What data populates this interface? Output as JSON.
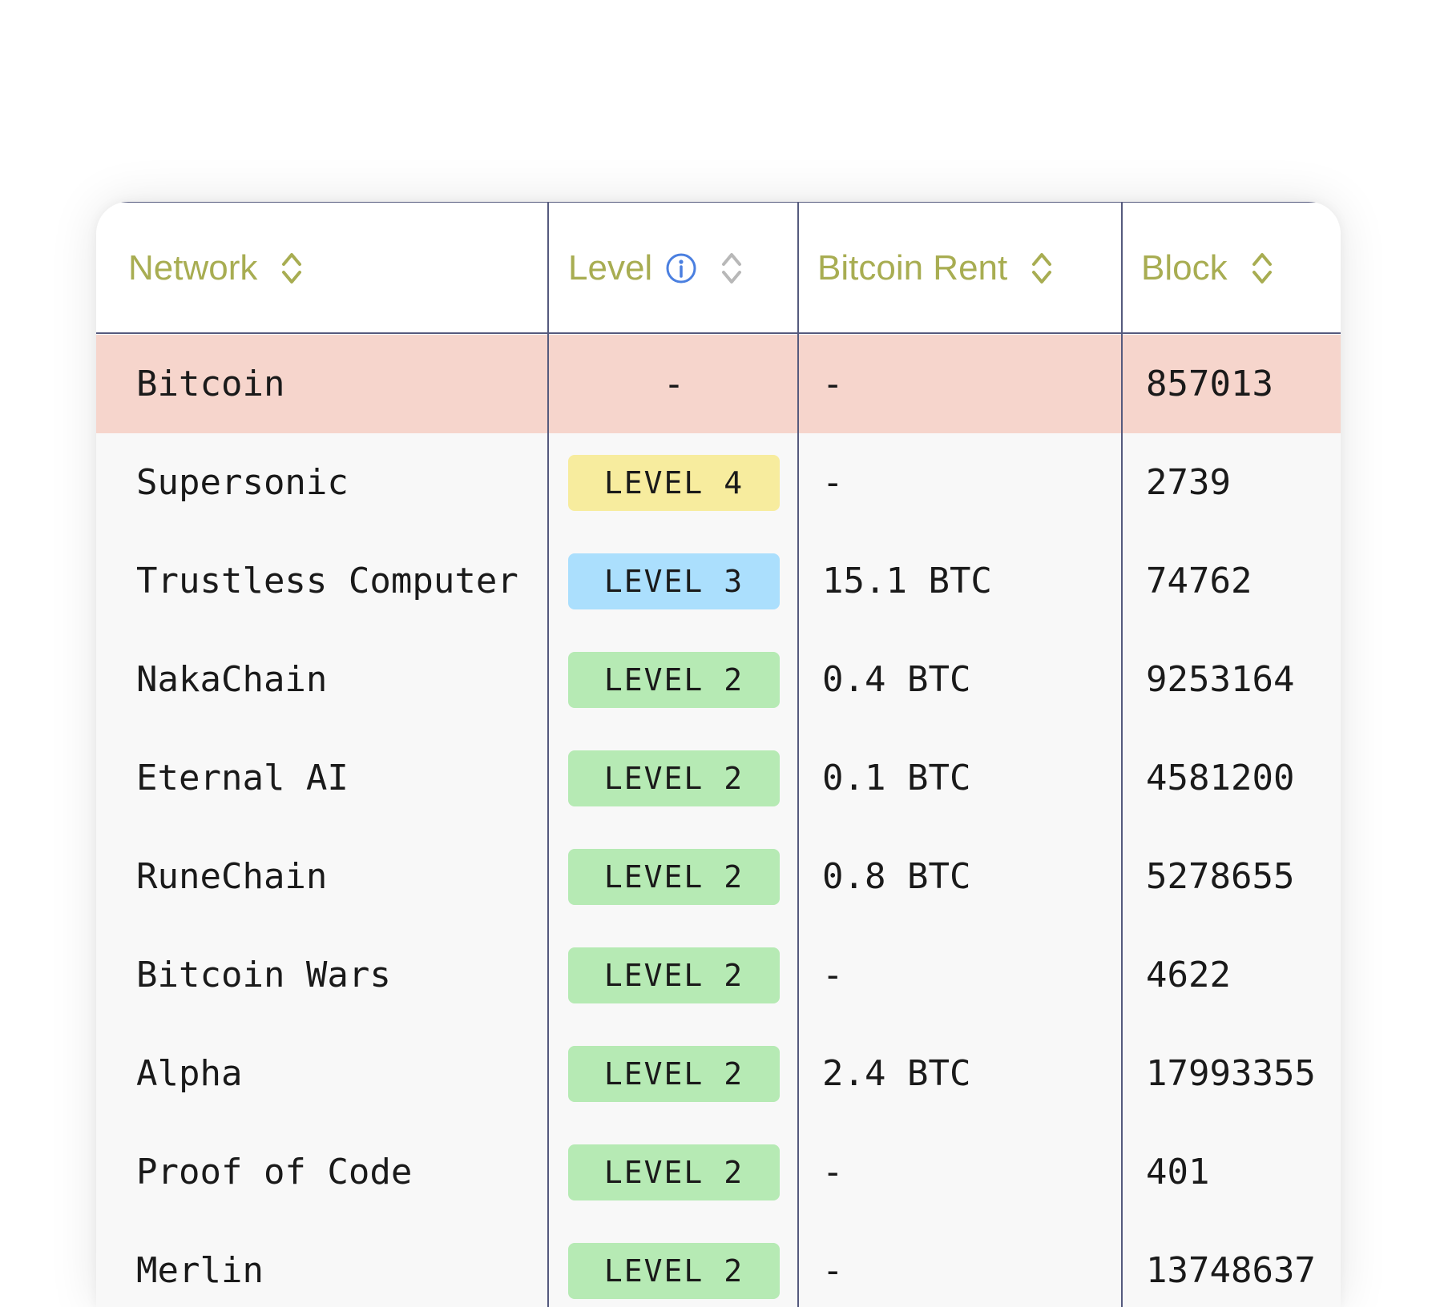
{
  "table": {
    "columns": [
      {
        "label": "Network",
        "info": false
      },
      {
        "label": "Level",
        "info": true
      },
      {
        "label": "Bitcoin Rent",
        "info": false
      },
      {
        "label": "Block",
        "info": false
      }
    ],
    "rows": [
      {
        "network": "Bitcoin",
        "level": "-",
        "rent": "-",
        "block": "857013",
        "highlight": true
      },
      {
        "network": "Supersonic",
        "level": "LEVEL 4",
        "level_color": "#f7ec9e",
        "rent": "-",
        "block": "2739"
      },
      {
        "network": "Trustless Computer",
        "level": "LEVEL 3",
        "level_color": "#abdffd",
        "rent": "15.1 BTC",
        "block": "74762"
      },
      {
        "network": "NakaChain",
        "level": "LEVEL 2",
        "level_color": "#b6eab4",
        "rent": "0.4 BTC",
        "block": "9253164"
      },
      {
        "network": "Eternal AI",
        "level": "LEVEL 2",
        "level_color": "#b6eab4",
        "rent": "0.1 BTC",
        "block": "4581200"
      },
      {
        "network": "RuneChain",
        "level": "LEVEL 2",
        "level_color": "#b6eab4",
        "rent": "0.8 BTC",
        "block": "5278655"
      },
      {
        "network": "Bitcoin Wars",
        "level": "LEVEL 2",
        "level_color": "#b6eab4",
        "rent": "-",
        "block": "4622"
      },
      {
        "network": "Alpha",
        "level": "LEVEL 2",
        "level_color": "#b6eab4",
        "rent": "2.4 BTC",
        "block": "17993355"
      },
      {
        "network": "Proof of Code",
        "level": "LEVEL 2",
        "level_color": "#b6eab4",
        "rent": "-",
        "block": "401"
      },
      {
        "network": "Merlin",
        "level": "LEVEL 2",
        "level_color": "#b6eab4",
        "rent": "-",
        "block": "13748637"
      }
    ]
  },
  "colors": {
    "header_text": "#a8ad52",
    "grid_line": "#555a7e",
    "highlight_row": "#f6d5cc",
    "info_icon": "#4a7fe0",
    "sort_icon_header": "#a8ad52",
    "sort_icon_level": "#b8b8b8"
  },
  "icons": {
    "sort": "sort-updown-icon",
    "info": "info-icon"
  }
}
